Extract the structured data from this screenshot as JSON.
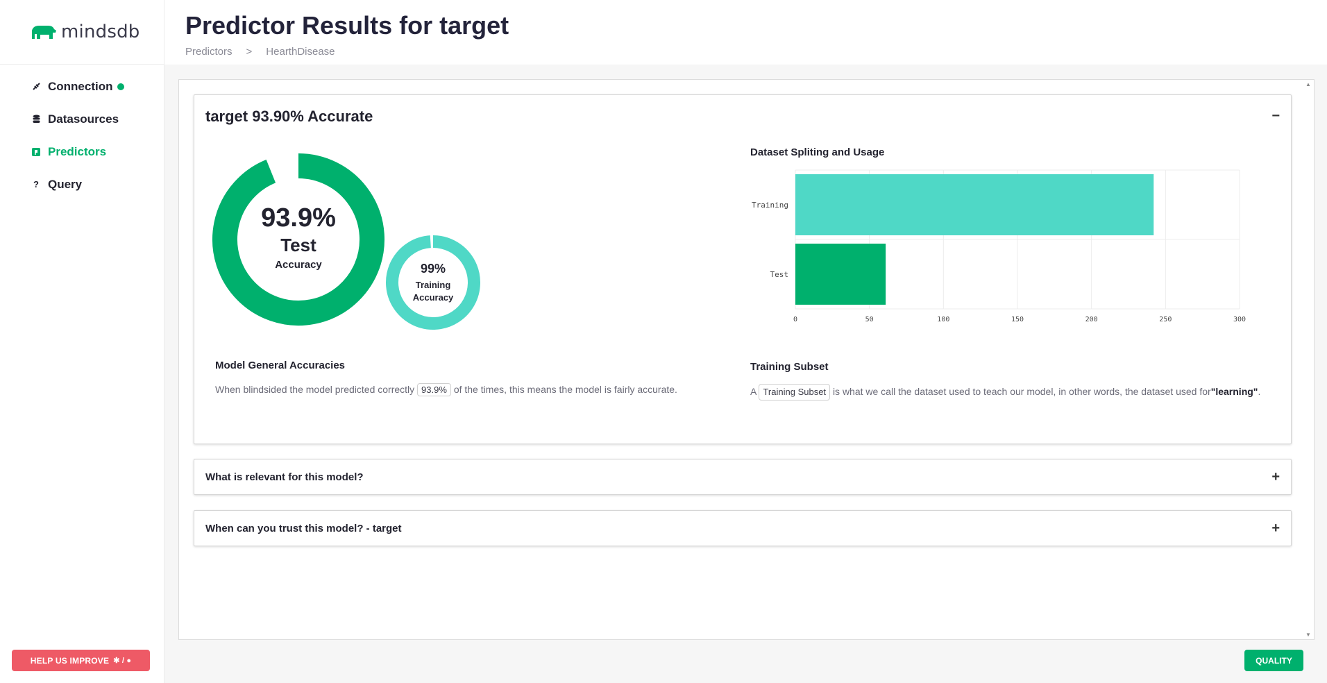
{
  "app": {
    "logo_text": "mindsdb"
  },
  "sidebar": {
    "items": [
      {
        "label": "Connection",
        "icon": "connection-icon",
        "status": "connected"
      },
      {
        "label": "Datasources",
        "icon": "database-icon"
      },
      {
        "label": "Predictors",
        "icon": "predictor-icon",
        "active": true
      },
      {
        "label": "Query",
        "icon": "question-icon"
      }
    ],
    "help_button": "HELP US IMPROVE",
    "help_icons": "🐞 / 💡"
  },
  "header": {
    "title": "Predictor Results for target",
    "breadcrumb": [
      "Predictors",
      ">",
      "HearthDisease"
    ]
  },
  "accuracy_card": {
    "title": "target 93.90% Accurate",
    "toggle": "−",
    "test_accuracy": {
      "value": "93.9%",
      "label": "Test",
      "sub": "Accuracy",
      "fraction": 0.939
    },
    "training_accuracy": {
      "value": "99%",
      "label_line1": "Training",
      "label_line2": "Accuracy",
      "fraction": 0.99
    },
    "model_general": {
      "title": "Model General Accuracies",
      "text_before": "When blindsided the model predicted correctly",
      "pill": "93.9%",
      "text_after": "of the times, this means the model is fairly accurate."
    },
    "training_subset": {
      "title": "Training Subset",
      "text_before": "A",
      "pill": "Training Subset",
      "text_mid": "is what we call the dataset used to teach our model, in other words, the dataset used for",
      "bold_word": "\"learning\"",
      "text_end": "."
    }
  },
  "chart_data": {
    "type": "bar",
    "orientation": "horizontal",
    "title": "Dataset Spliting and Usage",
    "categories": [
      "Training",
      "Test"
    ],
    "values": [
      242,
      61
    ],
    "xlim": [
      0,
      300
    ],
    "xticks": [
      0,
      50,
      100,
      150,
      200,
      250,
      300
    ],
    "colors": [
      "#4fd8c6",
      "#00b06d"
    ],
    "grid": true
  },
  "collapsed_cards": [
    {
      "title": "What is relevant for this model?",
      "toggle": "+"
    },
    {
      "title": "When can you trust this model? - target",
      "toggle": "+"
    }
  ],
  "quality_button": "QUALITY",
  "colors": {
    "accent": "#00b06d",
    "accent_light": "#4fd8c6",
    "danger": "#ee5a66"
  }
}
